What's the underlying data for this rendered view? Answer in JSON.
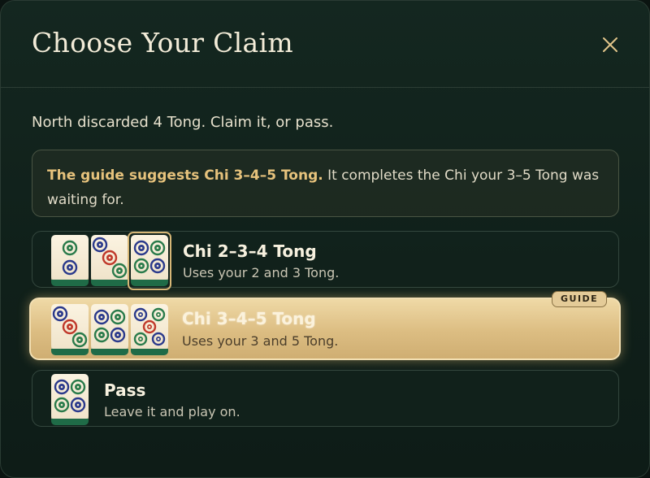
{
  "dialog": {
    "title": "Choose Your Claim",
    "close_icon": "close-icon",
    "subtitle": "North discarded 4 Tong. Claim it, or pass."
  },
  "hint": {
    "strong": "The guide suggests Chi 3–4–5 Tong.",
    "rest": " It completes the Chi your 3–5 Tong was waiting for."
  },
  "options": [
    {
      "label": "Chi 2–3–4 Tong",
      "desc": "Uses your 2 and 3 Tong.",
      "tiles": [
        "2 Tong",
        "3 Tong",
        "4 Tong"
      ],
      "claimed_tile": "4 Tong",
      "selected": false
    },
    {
      "label": "Chi 3–4–5 Tong",
      "desc": "Uses your 3 and 5 Tong.",
      "tiles": [
        "3 Tong",
        "4 Tong",
        "5 Tong"
      ],
      "selected": true,
      "badge": "GUIDE"
    },
    {
      "label": "Pass",
      "desc": "Leave it and play on.",
      "tiles": [
        "4 Tong"
      ],
      "selected": false
    }
  ],
  "colors": {
    "background": "#10201a",
    "accent_gold": "#e6c27c",
    "selected_option": "#dcbd82",
    "tile_base": "#1f6b47",
    "dot_green": "#2a7b4b",
    "dot_blue": "#2b3a8c",
    "dot_red": "#c0392b"
  }
}
